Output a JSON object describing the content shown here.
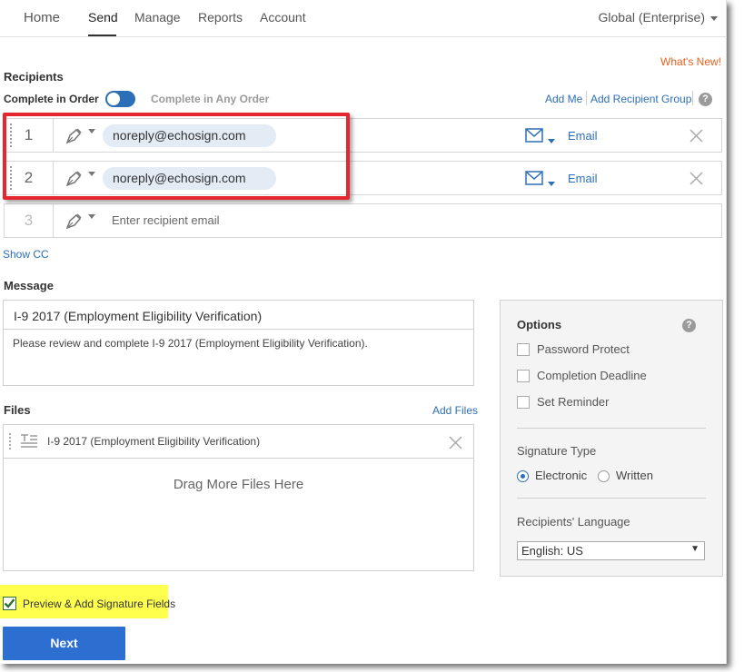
{
  "nav": {
    "items": [
      "Home",
      "Send",
      "Manage",
      "Reports",
      "Account"
    ],
    "active": "Send",
    "account_menu": "Global (Enterprise)"
  },
  "whats_new": "What's New!",
  "recipients": {
    "title": "Recipients",
    "complete_in_order": "Complete in Order",
    "complete_in_any_order": "Complete in Any Order",
    "order_toggle_on": true,
    "add_me": "Add Me",
    "add_recipient_group": "Add Recipient Group",
    "help": "?",
    "rows": [
      {
        "number": "1",
        "email": "noreply@echosign.com",
        "delivery": "Email"
      },
      {
        "number": "2",
        "email": "noreply@echosign.com",
        "delivery": "Email"
      },
      {
        "number": "3",
        "email": "",
        "placeholder": "Enter recipient email"
      }
    ],
    "show_cc": "Show CC"
  },
  "message": {
    "title": "Message",
    "subject": "I-9 2017 (Employment Eligibility Verification)",
    "body": "Please review and complete I-9 2017 (Employment Eligibility Verification)."
  },
  "files": {
    "title": "Files",
    "add_files": "Add Files",
    "items": [
      {
        "name": "I-9 2017 (Employment Eligibility Verification)"
      }
    ],
    "drop_text": "Drag More Files Here"
  },
  "options": {
    "title": "Options",
    "help": "?",
    "checkboxes": [
      {
        "label": "Password Protect",
        "checked": false
      },
      {
        "label": "Completion Deadline",
        "checked": false
      },
      {
        "label": "Set Reminder",
        "checked": false
      }
    ],
    "signature_type": {
      "title": "Signature Type",
      "choices": [
        "Electronic",
        "Written"
      ],
      "selected": "Electronic"
    },
    "language": {
      "title": "Recipients' Language",
      "selected": "English: US"
    }
  },
  "preview": {
    "label": "Preview & Add Signature Fields",
    "checked": true
  },
  "next_button": "Next",
  "colors": {
    "accent_blue": "#2d6fb6",
    "button_blue": "#2d6fd0",
    "whats_new_orange": "#e8601c",
    "highlight_red": "#e5262e",
    "highlight_yellow": "#ffff4d"
  }
}
